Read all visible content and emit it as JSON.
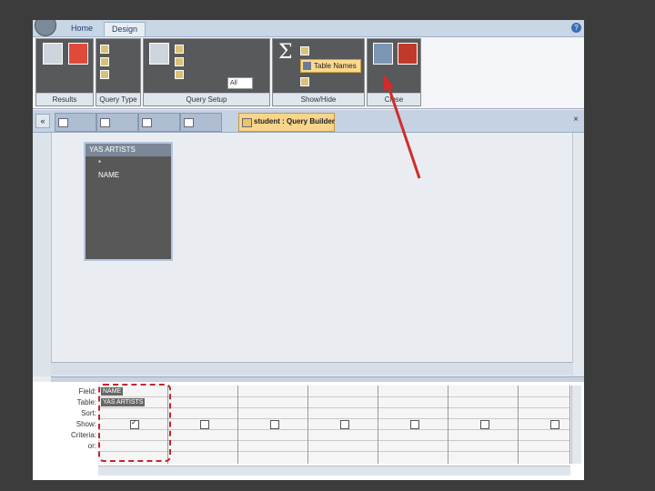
{
  "ribbon": {
    "tabs": [
      {
        "label": "Home"
      },
      {
        "label": "Design"
      }
    ],
    "help": "?",
    "groups": {
      "results": {
        "label": "Results"
      },
      "query_type": {
        "label": "Query Type"
      },
      "query_setup": {
        "label": "Query Setup",
        "all_value": "All"
      },
      "show_hide": {
        "label": "Show/Hide",
        "table_names": "Table Names"
      },
      "close": {
        "label": "Close"
      }
    }
  },
  "document": {
    "active_tab": "student : Query Builder",
    "close": "×"
  },
  "design_view": {
    "table_title": "YAS ARTISTS",
    "table_fields": [
      "*",
      "NAME"
    ]
  },
  "grid": {
    "row_labels": [
      "Field:",
      "Table:",
      "Sort:",
      "Show:",
      "Criteria:",
      "or:"
    ],
    "first_column": {
      "field": "NAME",
      "table": "YAS ARTISTS"
    }
  },
  "colors": {
    "arrow": "#d42a2a",
    "highlight_border": "#c0272d",
    "active_tab": "#f8d58a"
  }
}
